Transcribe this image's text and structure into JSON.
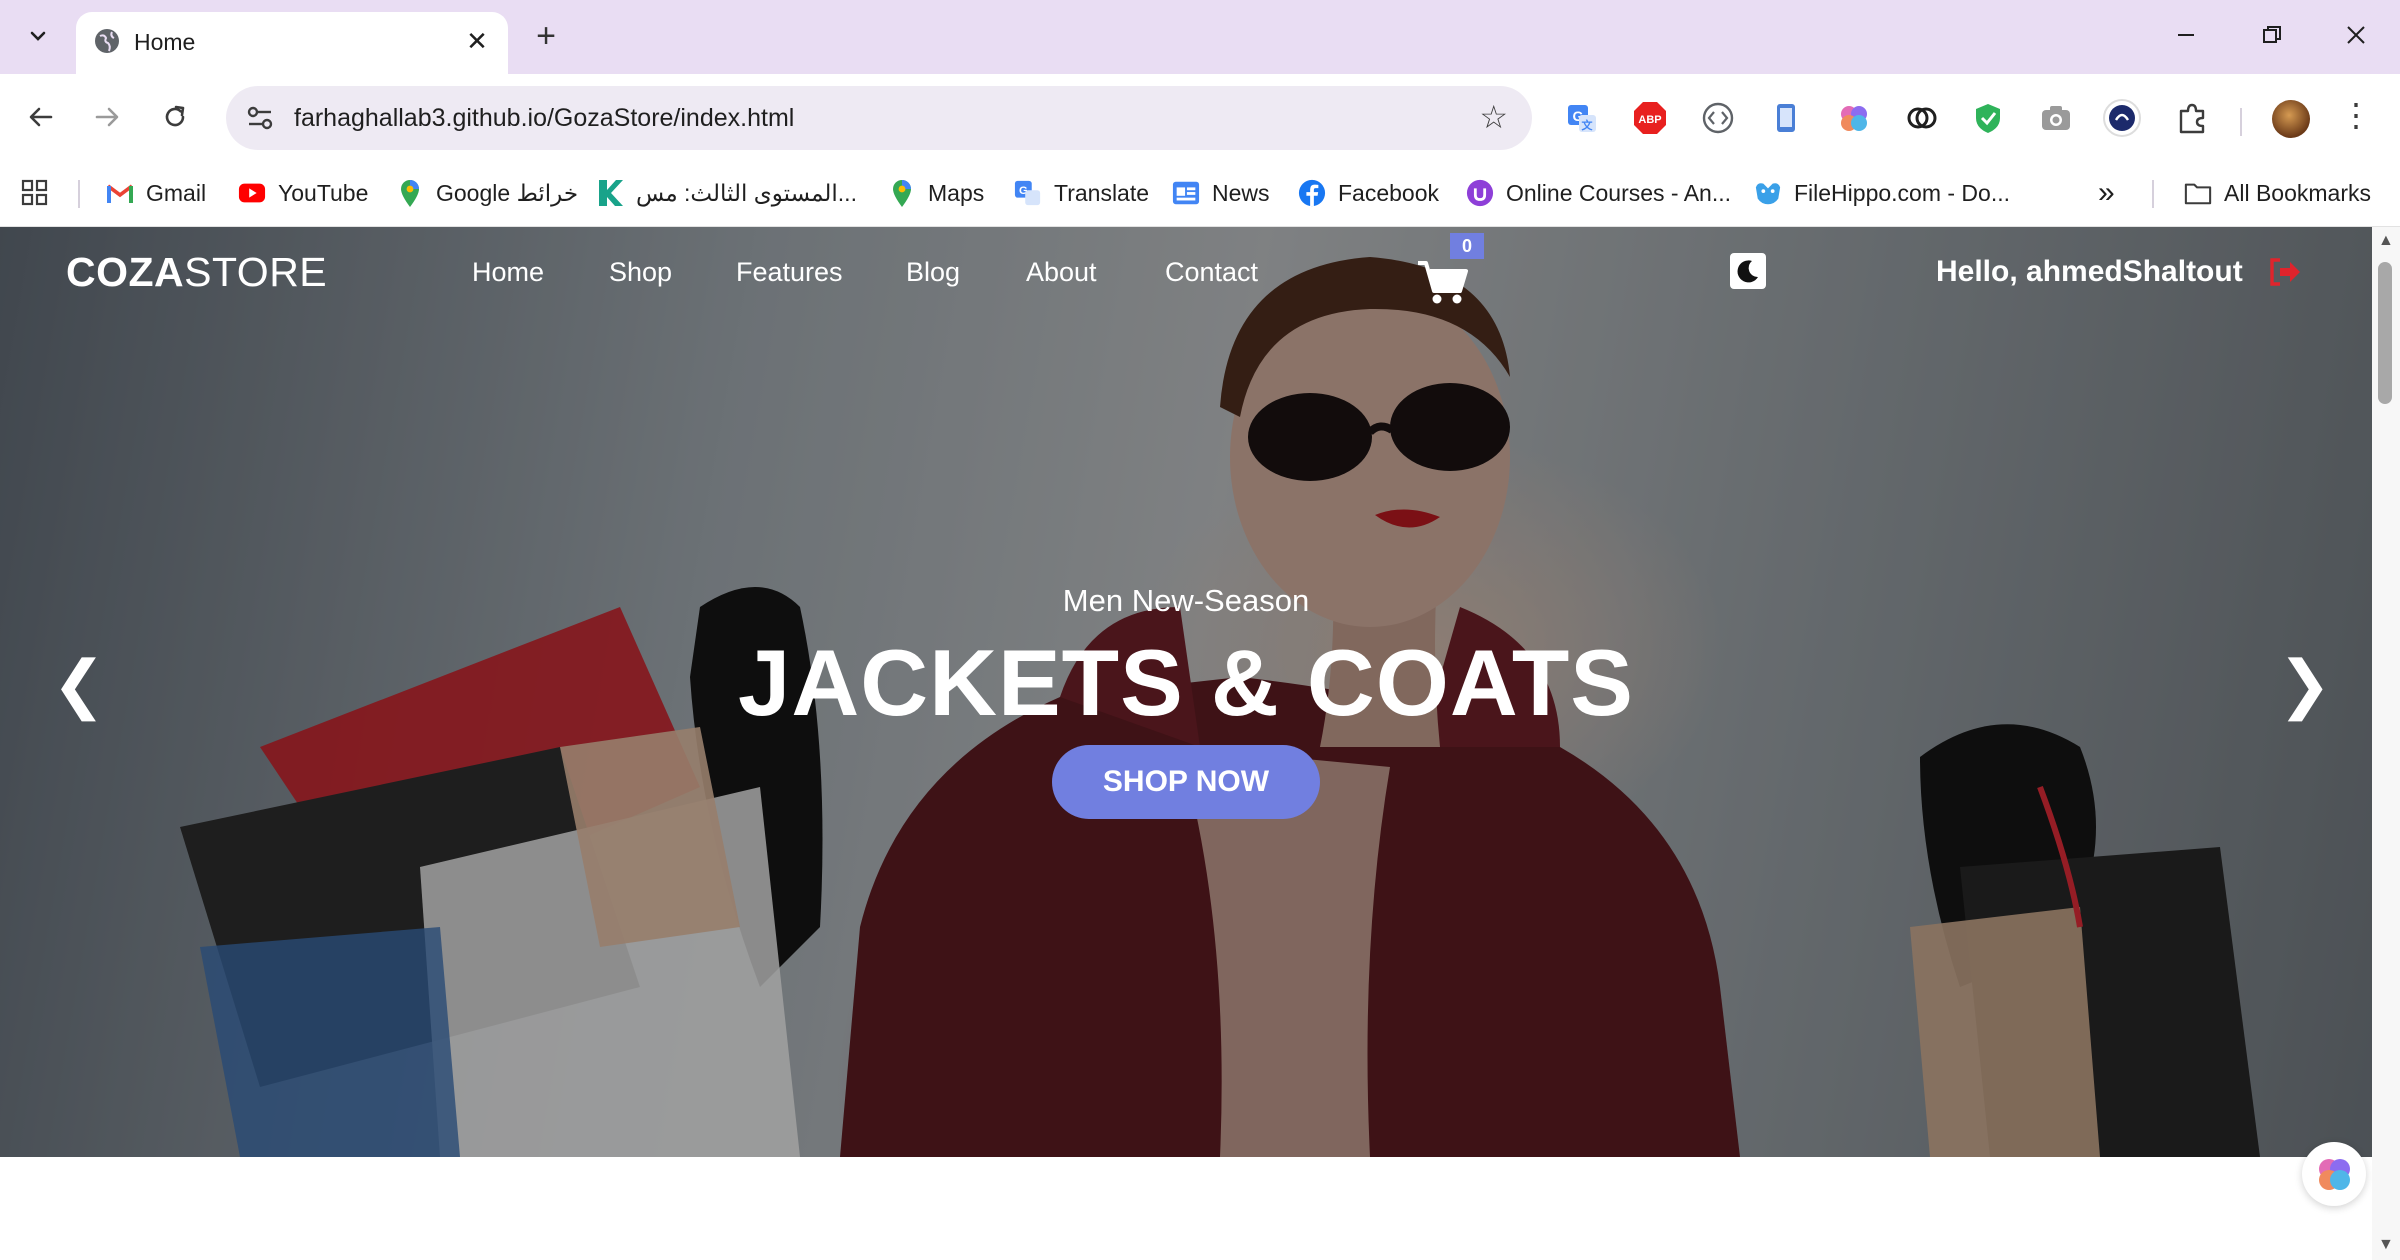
{
  "browser": {
    "tab_title": "Home",
    "url": "farhaghallab3.github.io/GozaStore/index.html",
    "bookmarks": [
      {
        "label": "Gmail",
        "icon": "gmail-icon"
      },
      {
        "label": "YouTube",
        "icon": "youtube-icon"
      },
      {
        "label": "Google خرائط",
        "icon": "maps-icon"
      },
      {
        "label": "المستوى الثالث: مس...",
        "icon": "k-icon"
      },
      {
        "label": "Maps",
        "icon": "maps-icon"
      },
      {
        "label": "Translate",
        "icon": "translate-icon"
      },
      {
        "label": "News",
        "icon": "news-icon"
      },
      {
        "label": "Facebook",
        "icon": "facebook-icon"
      },
      {
        "label": "Online Courses - An...",
        "icon": "udemy-icon"
      },
      {
        "label": "FileHippo.com - Do...",
        "icon": "filehippo-icon"
      }
    ],
    "overflow_label": "»",
    "all_bookmarks": "All Bookmarks",
    "extensions": [
      {
        "name": "google-translate-icon",
        "color": "#4285f4"
      },
      {
        "name": "adblock-icon",
        "color": "#e8201f",
        "text": "ABP"
      },
      {
        "name": "code-icon",
        "color": "#5f6368"
      },
      {
        "name": "phone-icon",
        "color": "#4a7fd6"
      },
      {
        "name": "brain-icon",
        "color": "#b56ce6"
      },
      {
        "name": "chain-icon",
        "color": "#1f1f1f"
      },
      {
        "name": "shield-icon",
        "color": "#2fb35a"
      },
      {
        "name": "camera-icon",
        "color": "#9a9a9a"
      },
      {
        "name": "vpn-icon",
        "color": "#1c2a6b"
      },
      {
        "name": "puzzle-icon",
        "color": "#3c3c3c"
      }
    ]
  },
  "site": {
    "logo_bold": "COZA",
    "logo_light": "STORE",
    "menu": [
      "Home",
      "Shop",
      "Features",
      "Blog",
      "About",
      "Contact"
    ],
    "cart_count": "0",
    "greeting": "Hello, ahmedShaltout",
    "accent_color": "#717fe0"
  },
  "hero": {
    "subtitle": "Men New-Season",
    "headline": "JACKETS & COATS",
    "cta": "SHOP NOW",
    "prev_arrow": "❮",
    "next_arrow": "❯"
  }
}
